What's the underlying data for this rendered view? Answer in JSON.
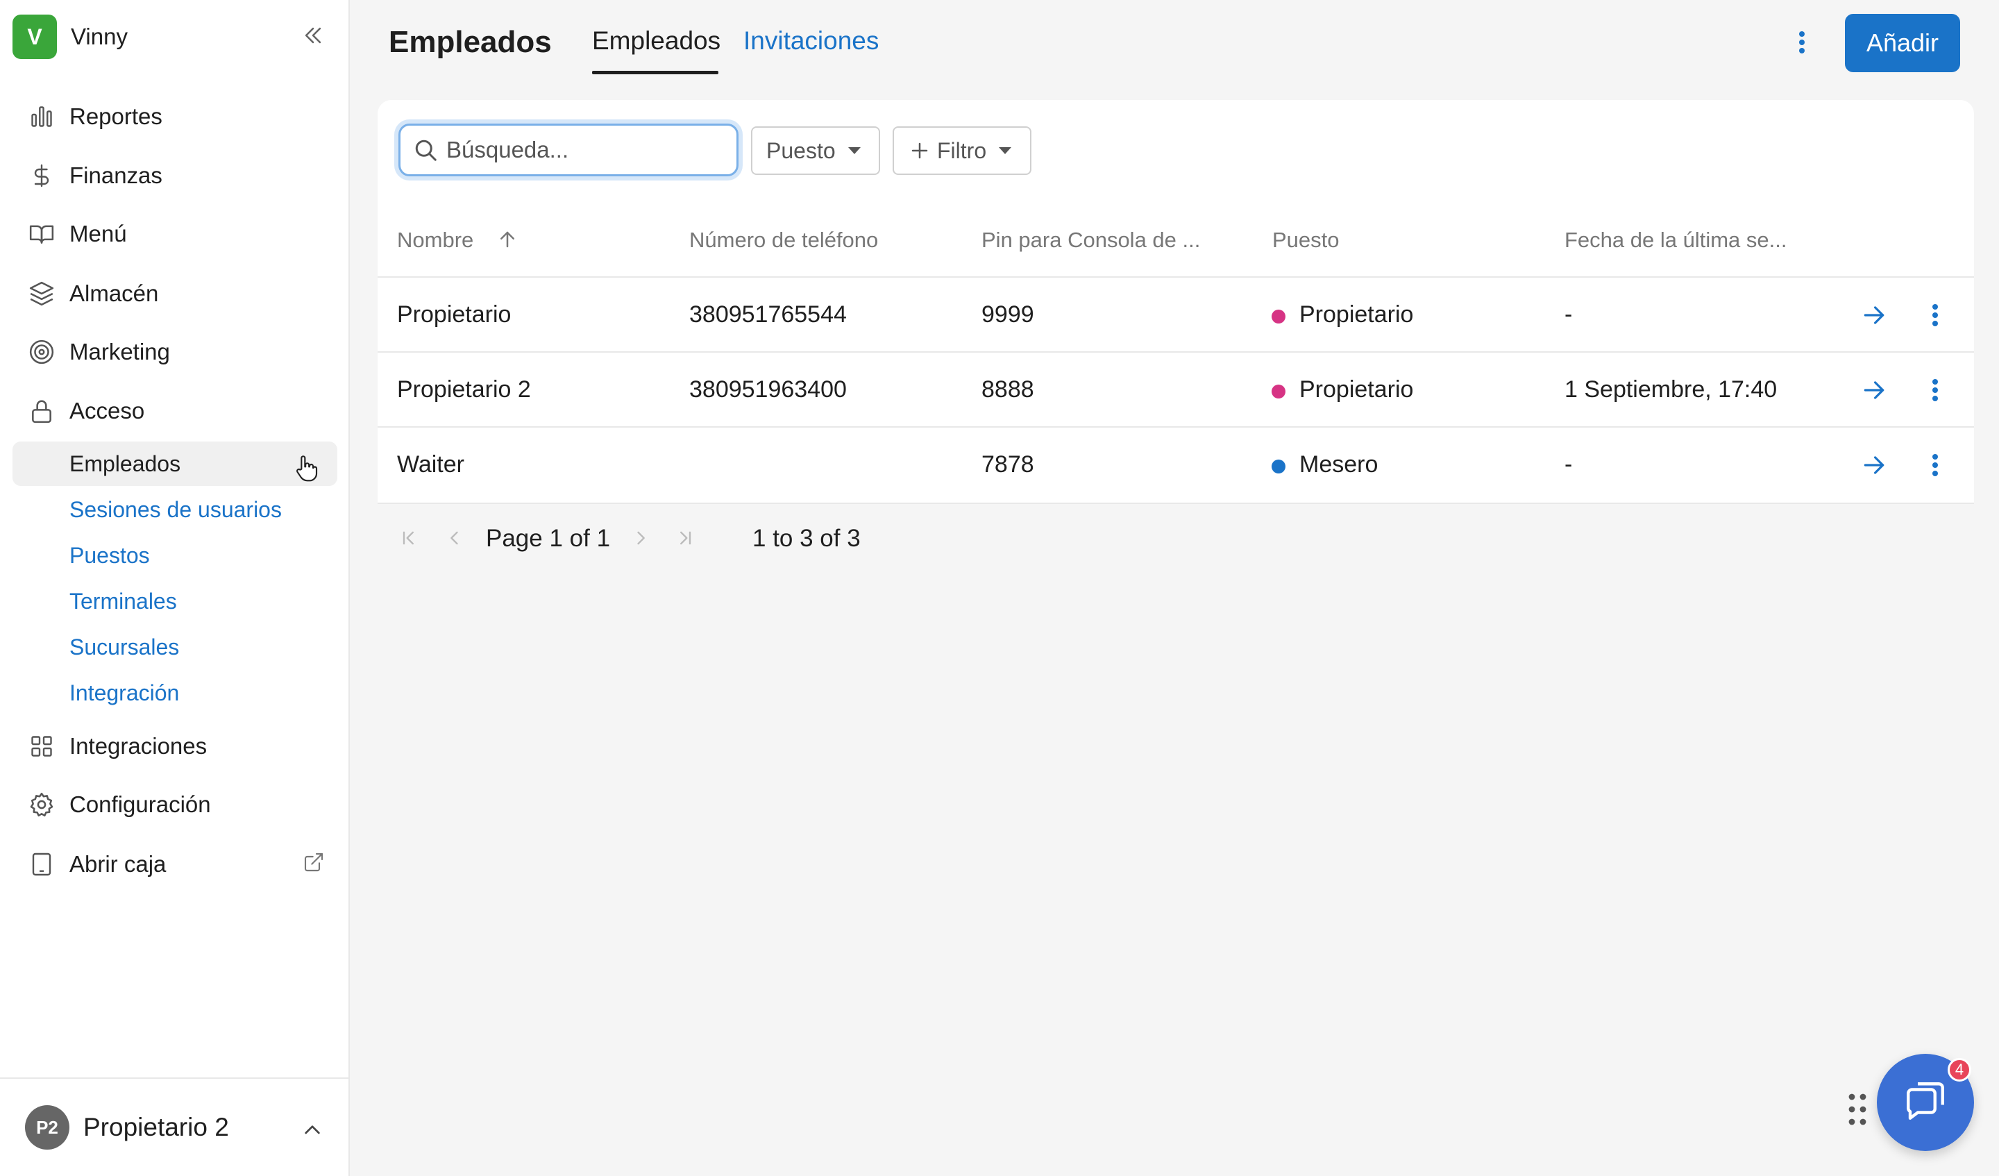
{
  "brand": {
    "initial": "V",
    "name": "Vinny",
    "color": "#3aa63a"
  },
  "sidebar": {
    "items": [
      {
        "label": "Reportes",
        "icon": "bar-chart-icon"
      },
      {
        "label": "Finanzas",
        "icon": "dollar-icon"
      },
      {
        "label": "Menú",
        "icon": "book-icon"
      },
      {
        "label": "Almacén",
        "icon": "layers-icon"
      },
      {
        "label": "Marketing",
        "icon": "target-icon"
      },
      {
        "label": "Acceso",
        "icon": "lock-icon"
      }
    ],
    "sub_items": [
      {
        "label": "Empleados",
        "active": true
      },
      {
        "label": "Sesiones de usuarios"
      },
      {
        "label": "Puestos"
      },
      {
        "label": "Terminales"
      },
      {
        "label": "Sucursales"
      },
      {
        "label": "Integración"
      }
    ],
    "bottom_items": [
      {
        "label": "Integraciones",
        "icon": "grid-icon"
      },
      {
        "label": "Configuración",
        "icon": "gear-icon"
      },
      {
        "label": "Abrir caja",
        "icon": "tablet-icon"
      }
    ]
  },
  "user": {
    "initials": "P2",
    "name": "Propietario 2"
  },
  "header": {
    "title": "Empleados",
    "tabs": [
      {
        "label": "Empleados",
        "active": true
      },
      {
        "label": "Invitaciones"
      }
    ],
    "add_label": "Añadir"
  },
  "toolbar": {
    "search_placeholder": "Búsqueda...",
    "role_filter": "Puesto",
    "filter_label": "Filtro"
  },
  "table": {
    "columns": [
      "Nombre",
      "Número de teléfono",
      "Pin para Consola de ...",
      "Puesto",
      "Fecha de la última se..."
    ],
    "rows": [
      {
        "name": "Propietario",
        "phone": "380951765544",
        "pin": "9999",
        "role": "Propietario",
        "role_color": "#d63384",
        "last_session": "-"
      },
      {
        "name": "Propietario 2",
        "phone": "380951963400",
        "pin": "8888",
        "role": "Propietario",
        "role_color": "#d63384",
        "last_session": "1 Septiembre, 17:40"
      },
      {
        "name": "Waiter",
        "phone": "",
        "pin": "7878",
        "role": "Mesero",
        "role_color": "#1a73c8",
        "last_session": "-"
      }
    ]
  },
  "pagination": {
    "page_label": "Page 1 of 1",
    "range_label": "1 to 3 of 3"
  },
  "chat": {
    "badge": "4"
  },
  "colors": {
    "accent": "#1a73c8",
    "chat": "#3b6fd4",
    "badge": "#e8455a"
  }
}
